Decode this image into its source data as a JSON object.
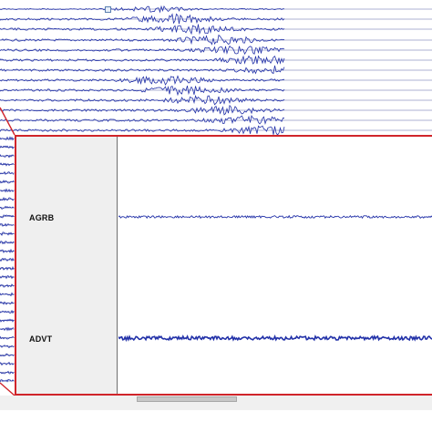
{
  "zoom_panel": {
    "stations": [
      {
        "label": "AGRB"
      },
      {
        "label": "ADVT"
      }
    ]
  },
  "colors": {
    "trace": "#2231a8",
    "grid_line": "#5a63a8",
    "zoom_border": "#d0242a",
    "label_bg": "#efefef"
  },
  "controls": {
    "time_slider_handle": "slider-handle-icon",
    "horizontal_scrollbar": "scrollbar"
  }
}
